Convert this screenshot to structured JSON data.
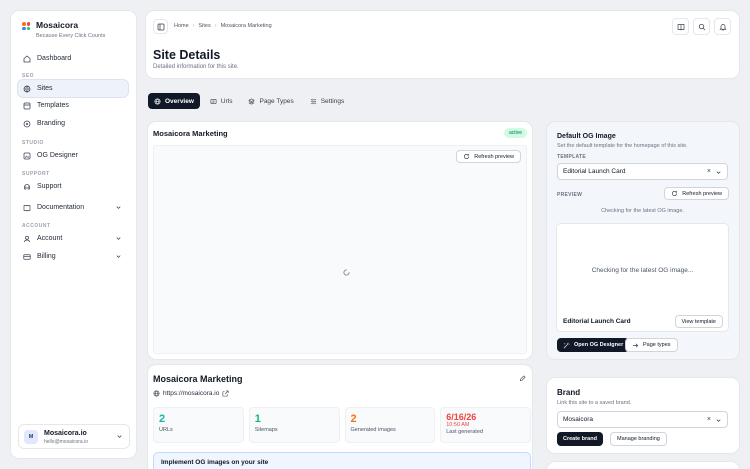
{
  "sidebar": {
    "brand_name": "Mosaicora",
    "brand_tagline": "Because Every Click Counts",
    "items": [
      {
        "label": "Dashboard"
      },
      {
        "section": "SEO"
      },
      {
        "label": "Sites",
        "active": true
      },
      {
        "label": "Templates"
      },
      {
        "label": "Branding"
      },
      {
        "section": "STUDIO"
      },
      {
        "label": "OG Designer"
      },
      {
        "section": "SUPPORT"
      },
      {
        "label": "Support"
      },
      {
        "label": "Documentation"
      },
      {
        "section": "ACCOUNT"
      },
      {
        "label": "Account"
      },
      {
        "label": "Billing"
      }
    ],
    "user": {
      "initial": "M",
      "name": "Mosaicora.io",
      "email": "hello@mosaicora.io"
    }
  },
  "header": {
    "breadcrumb": [
      "Home",
      "Sites",
      "Mosaicora Marketing"
    ],
    "title": "Site Details",
    "subtitle": "Detailed information for this site."
  },
  "tabs": [
    {
      "label": "Overview",
      "active": true
    },
    {
      "label": "Urls"
    },
    {
      "label": "Page Types"
    },
    {
      "label": "Settings"
    }
  ],
  "preview": {
    "site_name": "Mosaicora Marketing",
    "status": "active",
    "refresh_label": "Refresh preview"
  },
  "site_info": {
    "name": "Mosaicora Marketing",
    "url": "https://mosaicora.io",
    "stats": [
      {
        "value": "2",
        "label": "URLs",
        "color": "#14b8a6"
      },
      {
        "value": "1",
        "label": "Sitemaps",
        "color": "#10b981"
      },
      {
        "value": "2",
        "label": "Generated images",
        "color": "#f97316"
      },
      {
        "value": "6/16/26",
        "sub": "10:50 AM",
        "label": "Last generated",
        "color": "#ef4444"
      }
    ],
    "callout_title": "Implement OG images on your site"
  },
  "og": {
    "title": "Default OG Image",
    "subtitle": "Set the default template for the homepage of this site.",
    "template_label": "TEMPLATE",
    "template_value": "Editorial Launch Card",
    "preview_label": "PREVIEW",
    "refresh_label": "Refresh preview",
    "checking_text": "Checking for the latest OG image.",
    "frame_text": "Checking for the latest OG image...",
    "card_name": "Editorial Launch Card",
    "view_template": "View template",
    "open_designer": "Open OG Designer",
    "page_types": "Page types"
  },
  "brand": {
    "title": "Brand",
    "subtitle": "Link this site to a saved brand.",
    "value": "Mosaicora",
    "create": "Create brand",
    "manage": "Manage branding"
  },
  "colors": {
    "accent": "#111827",
    "active_badge_bg": "#d1fae5",
    "active_badge_fg": "#047857"
  }
}
